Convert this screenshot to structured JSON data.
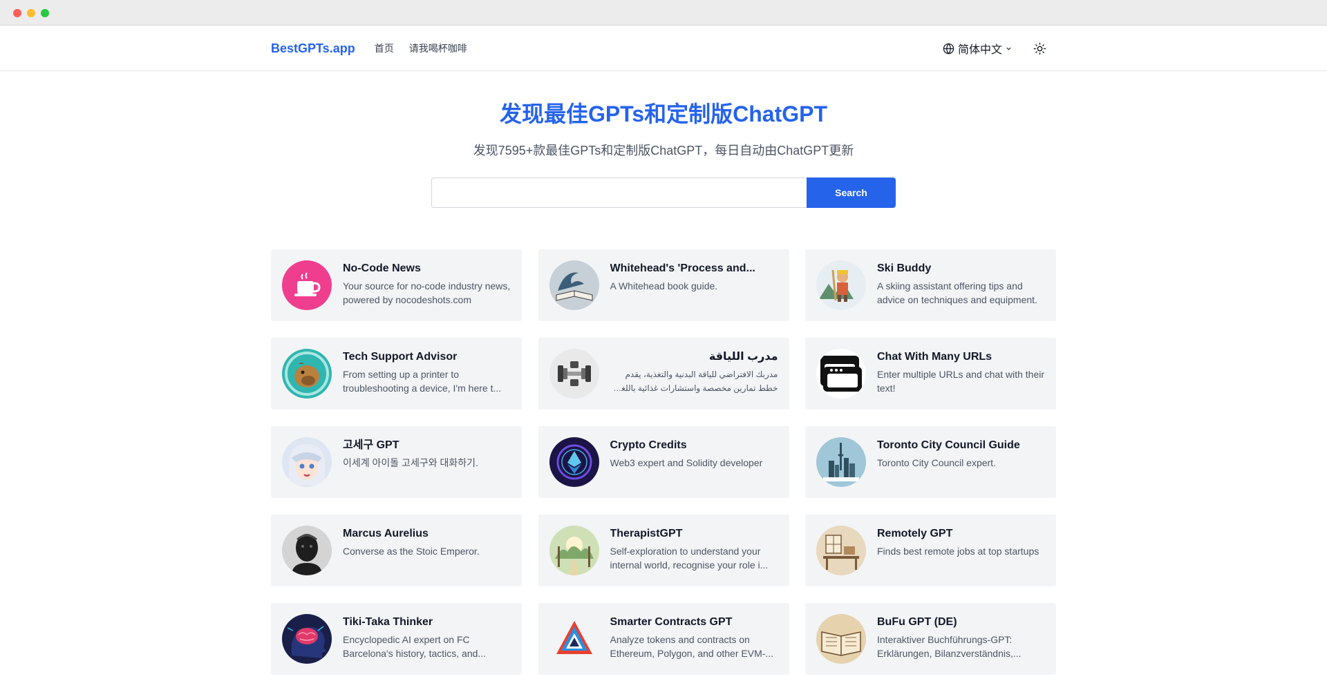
{
  "nav": {
    "brand": "BestGPTs.app",
    "links": [
      "首页",
      "请我喝杯咖啡"
    ],
    "language": "简体中文"
  },
  "hero": {
    "title": "发现最佳GPTs和定制版ChatGPT",
    "subtitle": "发现7595+款最佳GPTs和定制版ChatGPT，每日自动由ChatGPT更新"
  },
  "search": {
    "value": "",
    "button": "Search"
  },
  "colors": {
    "accent": "#2563eb",
    "card_bg": "#f3f4f6"
  },
  "cards": [
    {
      "title": "No-Code News",
      "desc": "Your source for no-code industry news, powered by nocodeshots.com",
      "icon": "coffee-cup-icon"
    },
    {
      "title": "Whitehead's 'Process and...",
      "desc": "A Whitehead book guide.",
      "icon": "wave-book-icon"
    },
    {
      "title": "Ski Buddy",
      "desc": "A skiing assistant offering tips and advice on techniques and equipment.",
      "icon": "skier-icon"
    },
    {
      "title": "Tech Support Advisor",
      "desc": "From setting up a printer to troubleshooting a device, I'm here t...",
      "icon": "capybara-icon"
    },
    {
      "title": "مدرب اللياقة",
      "desc": "مدربك الافتراضي للياقة البدنية والتغذية، يقدم خطط تمارين مخصصة واستشارات غذائية باللغة العربية.",
      "icon": "dumbbell-icon"
    },
    {
      "title": "Chat With Many URLs",
      "desc": "Enter multiple URLs and chat with their text!",
      "icon": "stacked-windows-icon"
    },
    {
      "title": "고세구 GPT",
      "desc": "이세계 아이돌 고세구와 대화하기.",
      "icon": "anime-girl-icon"
    },
    {
      "title": "Crypto Credits",
      "desc": "Web3 expert and Solidity developer",
      "icon": "ethereum-icon"
    },
    {
      "title": "Toronto City Council Guide",
      "desc": "Toronto City Council expert.",
      "icon": "city-skyline-icon"
    },
    {
      "title": "Marcus Aurelius",
      "desc": "Converse as the Stoic Emperor.",
      "icon": "statue-bust-icon"
    },
    {
      "title": "TherapistGPT",
      "desc": "Self-exploration to understand your internal world, recognise your role i...",
      "icon": "forest-path-icon"
    },
    {
      "title": "Remotely GPT",
      "desc": "Finds best remote jobs at top startups",
      "icon": "desk-sketch-icon"
    },
    {
      "title": "Tiki-Taka Thinker",
      "desc": "Encyclopedic AI expert on FC Barcelona's history, tactics, and...",
      "icon": "brain-head-icon"
    },
    {
      "title": "Smarter Contracts GPT",
      "desc": "Analyze tokens and contracts on Ethereum, Polygon, and other EVM-...",
      "icon": "triangle-logo-icon"
    },
    {
      "title": "BuFu GPT (DE)",
      "desc": "Interaktiver Buchführungs-GPT: Erklärungen, Bilanzverständnis,...",
      "icon": "open-book-icon"
    }
  ]
}
